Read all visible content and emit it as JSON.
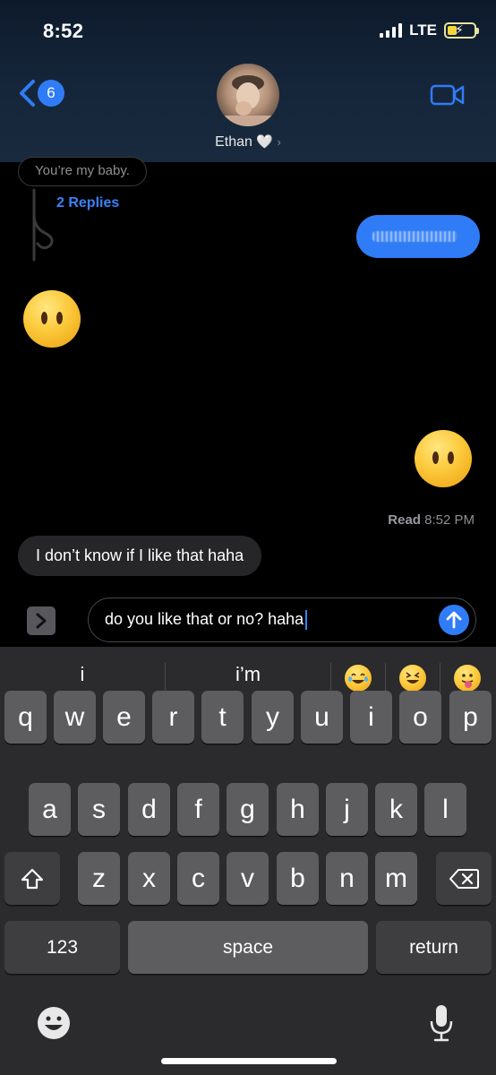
{
  "status_bar": {
    "time": "8:52",
    "network": "LTE"
  },
  "header": {
    "back_badge": "6",
    "contact_name": "Ethan",
    "heart": "🤍",
    "chevron": "›"
  },
  "thread": {
    "reply_preview": "You’re my baby.",
    "replies_link": "2 Replies",
    "read_receipt_label": "Read",
    "read_receipt_time": "8:52 PM",
    "received_message": "I don’t know if I like that haha"
  },
  "compose": {
    "text": "do you like that or no? haha"
  },
  "keyboard": {
    "suggestions": [
      "i",
      "i’m"
    ],
    "emoji_suggestions": [
      "joy-emoji",
      "grinning-squinting-emoji",
      "tongue-emoji"
    ],
    "row1": [
      "q",
      "w",
      "e",
      "r",
      "t",
      "y",
      "u",
      "i",
      "o",
      "p"
    ],
    "row2": [
      "a",
      "s",
      "d",
      "f",
      "g",
      "h",
      "j",
      "k",
      "l"
    ],
    "row3": [
      "z",
      "x",
      "c",
      "v",
      "b",
      "n",
      "m"
    ],
    "numbers_key": "123",
    "space_key": "space",
    "return_key": "return"
  },
  "colors": {
    "accent": "#2f7cf6",
    "received_bubble": "#262628",
    "keyboard_bg": "#2b2b2d",
    "key_bg": "#5d5d60"
  }
}
